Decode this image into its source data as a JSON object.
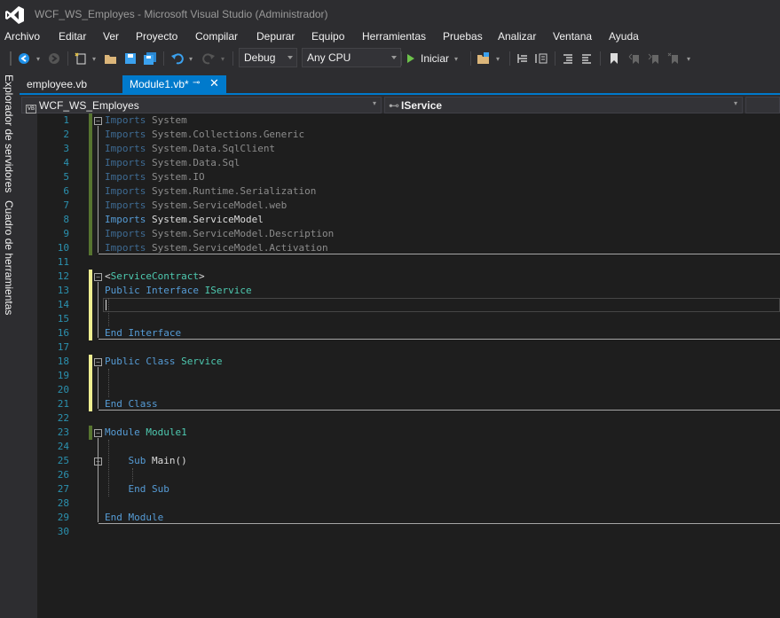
{
  "window": {
    "title": "WCF_WS_Employes - Microsoft Visual Studio (Administrador)"
  },
  "menu": [
    "Archivo",
    "Editar",
    "Ver",
    "Proyecto",
    "Compilar",
    "Depurar",
    "Equipo",
    "Herramientas",
    "Pruebas",
    "Analizar",
    "Ventana",
    "Ayuda"
  ],
  "toolbar": {
    "config": "Debug",
    "platform": "Any CPU",
    "start_label": "Iniciar"
  },
  "side_tabs": [
    "Explorador de servidores",
    "Cuadro de herramientas"
  ],
  "tabs": [
    {
      "label": "employee.vb"
    },
    {
      "label": "Module1.vb*"
    }
  ],
  "navbar": {
    "project": "WCF_WS_Employes",
    "member": "IService"
  },
  "colors": {
    "accent": "#007acc",
    "keyword": "#569cd6",
    "type": "#4ec9b0",
    "line_number": "#2b91af",
    "change_saved": "#577430",
    "change_unsaved": "#efef91"
  },
  "lines": [
    {
      "n": "1",
      "t": [
        {
          "c": "fdk",
          "s": "Imports "
        },
        {
          "c": "fd",
          "s": "System"
        }
      ]
    },
    {
      "n": "2",
      "t": [
        {
          "c": "fdk",
          "s": "Imports "
        },
        {
          "c": "fd",
          "s": "System.Collections.Generic"
        }
      ]
    },
    {
      "n": "3",
      "t": [
        {
          "c": "fdk",
          "s": "Imports "
        },
        {
          "c": "fd",
          "s": "System.Data.SqlClient"
        }
      ]
    },
    {
      "n": "4",
      "t": [
        {
          "c": "fdk",
          "s": "Imports "
        },
        {
          "c": "fd",
          "s": "System.Data.Sql"
        }
      ]
    },
    {
      "n": "5",
      "t": [
        {
          "c": "fdk",
          "s": "Imports "
        },
        {
          "c": "fd",
          "s": "System.IO"
        }
      ]
    },
    {
      "n": "6",
      "t": [
        {
          "c": "fdk",
          "s": "Imports "
        },
        {
          "c": "fd",
          "s": "System.Runtime.Serialization"
        }
      ]
    },
    {
      "n": "7",
      "t": [
        {
          "c": "fdk",
          "s": "Imports "
        },
        {
          "c": "fd",
          "s": "System.ServiceModel.web"
        }
      ]
    },
    {
      "n": "8",
      "t": [
        {
          "c": "kw",
          "s": "Imports "
        },
        {
          "c": "",
          "s": "System.ServiceModel"
        }
      ]
    },
    {
      "n": "9",
      "t": [
        {
          "c": "fdk",
          "s": "Imports "
        },
        {
          "c": "fd",
          "s": "System.ServiceModel.Description"
        }
      ]
    },
    {
      "n": "10",
      "t": [
        {
          "c": "fdk",
          "s": "Imports "
        },
        {
          "c": "fd",
          "s": "System.ServiceModel.Activation"
        }
      ]
    },
    {
      "n": "11",
      "t": []
    },
    {
      "n": "12",
      "t": [
        {
          "c": "",
          "s": "<"
        },
        {
          "c": "ty",
          "s": "ServiceContract"
        },
        {
          "c": "",
          "s": ">"
        }
      ]
    },
    {
      "n": "13",
      "t": [
        {
          "c": "kw",
          "s": "Public Interface "
        },
        {
          "c": "ty",
          "s": "IService"
        }
      ]
    },
    {
      "n": "14",
      "t": []
    },
    {
      "n": "15",
      "t": []
    },
    {
      "n": "16",
      "t": [
        {
          "c": "kw",
          "s": "End Interface"
        }
      ]
    },
    {
      "n": "17",
      "t": []
    },
    {
      "n": "18",
      "t": [
        {
          "c": "kw",
          "s": "Public Class "
        },
        {
          "c": "ty",
          "s": "Service"
        }
      ]
    },
    {
      "n": "19",
      "t": []
    },
    {
      "n": "20",
      "t": []
    },
    {
      "n": "21",
      "t": [
        {
          "c": "kw",
          "s": "End Class"
        }
      ]
    },
    {
      "n": "22",
      "t": []
    },
    {
      "n": "23",
      "t": [
        {
          "c": "kw",
          "s": "Module "
        },
        {
          "c": "ty",
          "s": "Module1"
        }
      ]
    },
    {
      "n": "24",
      "t": []
    },
    {
      "n": "25",
      "t": [
        {
          "c": "kw",
          "s": "    Sub "
        },
        {
          "c": "",
          "s": "Main()"
        }
      ]
    },
    {
      "n": "26",
      "t": []
    },
    {
      "n": "27",
      "t": [
        {
          "c": "kw",
          "s": "    End Sub"
        }
      ]
    },
    {
      "n": "28",
      "t": []
    },
    {
      "n": "29",
      "t": [
        {
          "c": "kw",
          "s": "End Module"
        }
      ]
    },
    {
      "n": "30",
      "t": []
    }
  ]
}
